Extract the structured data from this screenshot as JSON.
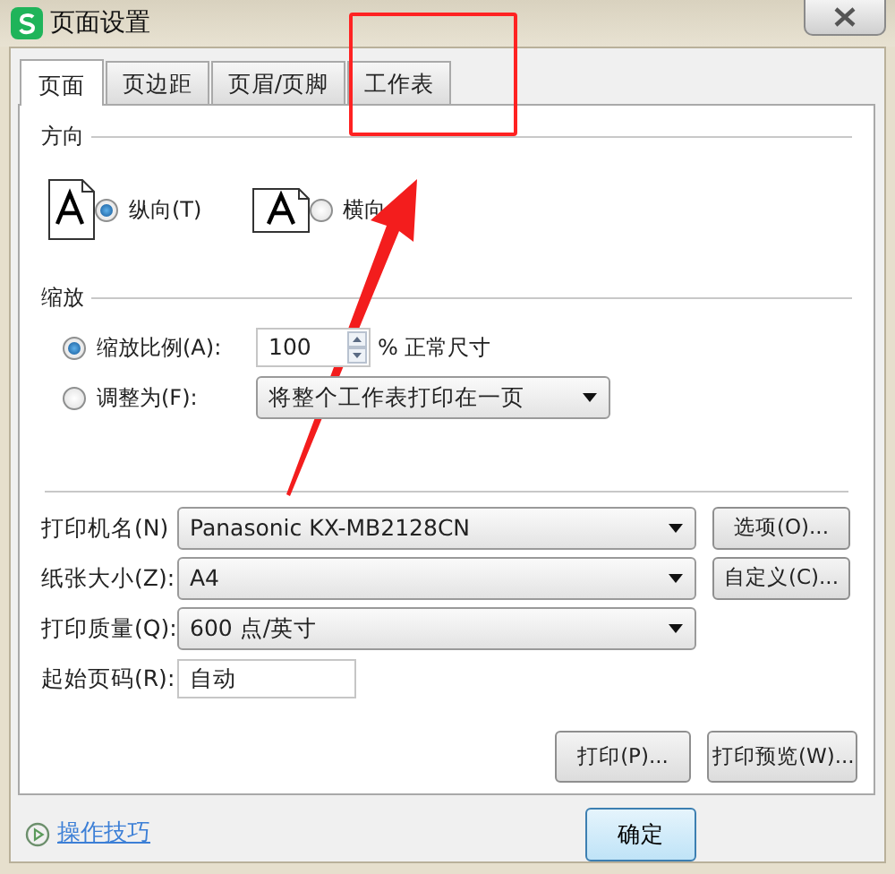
{
  "window": {
    "title": "页面设置"
  },
  "tabs": [
    {
      "label": "页面",
      "selected": true
    },
    {
      "label": "页边距",
      "selected": false
    },
    {
      "label": "页眉/页脚",
      "selected": false
    },
    {
      "label": "工作表",
      "selected": false
    }
  ],
  "orientation": {
    "heading": "方向",
    "options": [
      {
        "label": "纵向(T)",
        "kind": "portrait",
        "selected": true
      },
      {
        "label": "横向",
        "kind": "landscape",
        "selected": false
      }
    ]
  },
  "scaling": {
    "heading": "缩放",
    "options": [
      {
        "label": "缩放比例(A):",
        "kind": "spin",
        "selected": true,
        "value": "100",
        "suffix": "% 正常尺寸"
      },
      {
        "label": "调整为(F):",
        "kind": "select",
        "selected": false,
        "value": "将整个工作表打印在一页"
      }
    ]
  },
  "printer": [
    {
      "label": "打印机名(N)",
      "kind": "select",
      "value": "Panasonic KX-MB2128CN",
      "button": "选项(O)..."
    },
    {
      "label": "纸张大小(Z):",
      "kind": "select",
      "value": "A4",
      "button": "自定义(C)..."
    },
    {
      "label": "打印质量(Q):",
      "kind": "select",
      "value": "600 点/英寸"
    },
    {
      "label": "起始页码(R):",
      "kind": "input",
      "value": "自动"
    }
  ],
  "panel_buttons": [
    "打印(P)...",
    "打印预览(W)..."
  ],
  "footer": {
    "link": "操作技巧",
    "ok_button": "确定"
  },
  "annotations": {
    "highlight_box": true,
    "arrow": true
  }
}
